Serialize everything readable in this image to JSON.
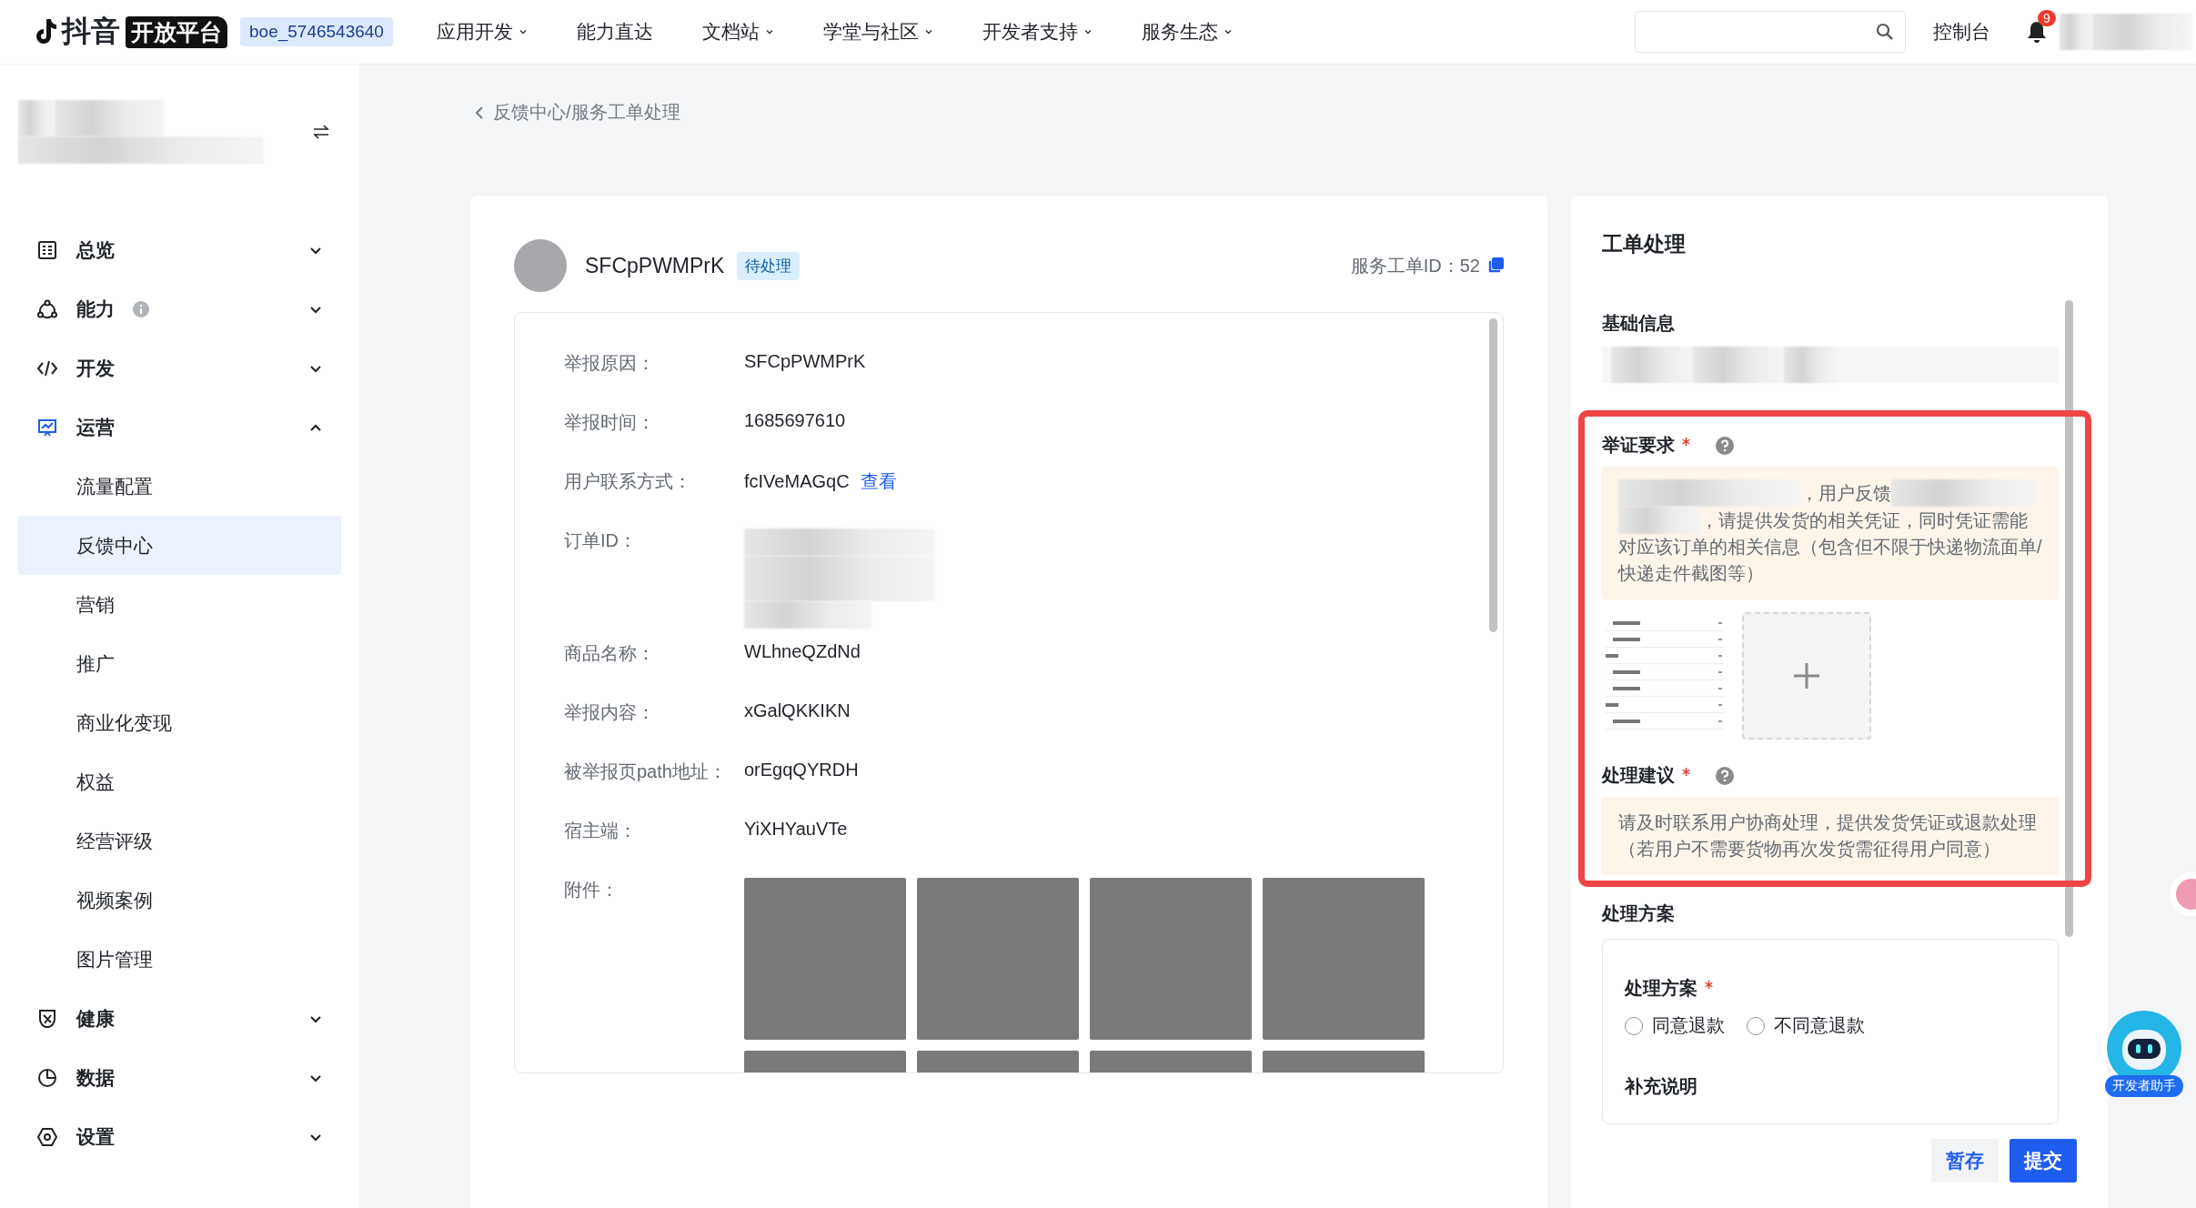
{
  "topbar": {
    "logo_text": "抖音",
    "logo_badge": "开放平台",
    "account": "boe_5746543640",
    "nav": [
      {
        "label": "应用开发",
        "dropdown": true
      },
      {
        "label": "能力直达",
        "dropdown": false
      },
      {
        "label": "文档站",
        "dropdown": true
      },
      {
        "label": "学堂与社区",
        "dropdown": true
      },
      {
        "label": "开发者支持",
        "dropdown": true
      },
      {
        "label": "服务生态",
        "dropdown": true
      }
    ],
    "console": "控制台",
    "notification_badge": "9"
  },
  "sidebar": {
    "items": [
      {
        "label": "总览",
        "info": false,
        "expanded": false,
        "selected": false
      },
      {
        "label": "能力",
        "info": true,
        "expanded": false,
        "selected": false
      },
      {
        "label": "开发",
        "info": false,
        "expanded": false,
        "selected": false
      },
      {
        "label": "运营",
        "info": false,
        "expanded": true,
        "selected": true,
        "children": [
          {
            "label": "流量配置",
            "selected": false
          },
          {
            "label": "反馈中心",
            "selected": true
          },
          {
            "label": "营销",
            "selected": false
          },
          {
            "label": "推广",
            "selected": false
          },
          {
            "label": "商业化变现",
            "selected": false
          },
          {
            "label": "权益",
            "selected": false
          },
          {
            "label": "经营评级",
            "selected": false
          },
          {
            "label": "视频案例",
            "selected": false
          },
          {
            "label": "图片管理",
            "selected": false
          }
        ]
      },
      {
        "label": "健康",
        "info": false,
        "expanded": false,
        "selected": false
      },
      {
        "label": "数据",
        "info": false,
        "expanded": false,
        "selected": false
      },
      {
        "label": "设置",
        "info": false,
        "expanded": false,
        "selected": false
      }
    ]
  },
  "breadcrumb": "反馈中心/服务工单处理",
  "ticket": {
    "name": "SFCpPWMPrK",
    "status": "待处理",
    "id_label": "服务工单ID：",
    "id_value": "52",
    "fields": [
      {
        "kind": "text",
        "label": "举报原因：",
        "value": "SFCpPWMPrK"
      },
      {
        "kind": "text",
        "label": "举报时间：",
        "value": "1685697610"
      },
      {
        "kind": "link",
        "label": "用户联系方式：",
        "value": "fcIVeMAGqC",
        "link": "查看"
      },
      {
        "kind": "blurred",
        "label": "订单ID："
      },
      {
        "kind": "text",
        "label": "商品名称：",
        "value": "WLhneQZdNd"
      },
      {
        "kind": "text",
        "label": "举报内容：",
        "value": "xGalQKKIKN"
      },
      {
        "kind": "text",
        "label": "被举报页path地址：",
        "value": "orEgqQYRDH"
      },
      {
        "kind": "text",
        "label": "宿主端：",
        "value": "YiXHYauVTe"
      },
      {
        "kind": "attachments",
        "label": "附件："
      }
    ]
  },
  "panel": {
    "title": "工单处理",
    "basic_title": "基础信息",
    "evidence": {
      "title": "举证要求",
      "required": true,
      "text_a": "，用户反馈",
      "text_b": "，请提供发货的相关凭证，同时凭证需能",
      "text_c": "对应该订单的相关信息（包含但不限于快递物流面单/快递走件截图等）"
    },
    "advice": {
      "title": "处理建议",
      "required": true,
      "text": "请及时联系用户协商处理，提供发货凭证或退款处理（若用户不需要货物再次发货需征得用户同意）"
    },
    "plan_title": "处理方案",
    "plan": {
      "label": "处理方案",
      "required": true,
      "options": [
        {
          "label": "同意退款",
          "selected": false
        },
        {
          "label": "不同意退款",
          "selected": false
        }
      ],
      "note_label": "补充说明"
    },
    "buttons": [
      {
        "label": "暂存",
        "kind": "secondary"
      },
      {
        "label": "提交",
        "kind": "primary"
      }
    ]
  },
  "assistant": "开发者助手"
}
